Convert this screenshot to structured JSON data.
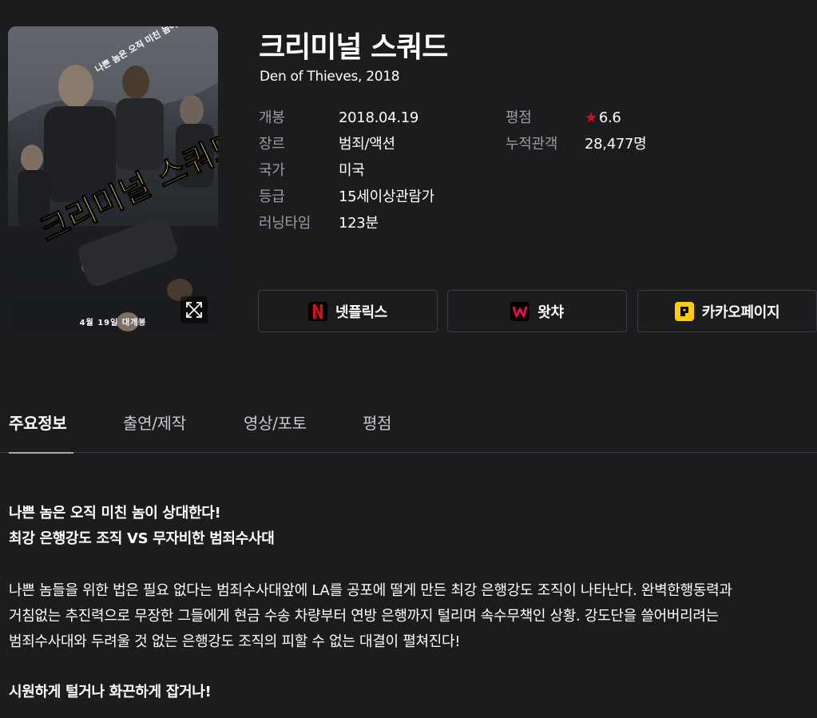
{
  "movie": {
    "title": "크리미널 스쿼드",
    "original_title_year": "Den of Thieves, 2018",
    "poster": {
      "tagline": "나쁜 놈은 오직 미친 놈이 상대한다!",
      "title_art": "크리미널 스쿼드",
      "release_note": "4월 19일 대개봉"
    }
  },
  "info": {
    "release_label": "개봉",
    "release_value": "2018.04.19",
    "genre_label": "장르",
    "genre_value": "범죄/액션",
    "country_label": "국가",
    "country_value": "미국",
    "rating_label": "등급",
    "rating_value": "15세이상관람가",
    "runtime_label": "러닝타임",
    "runtime_value": "123분",
    "score_label": "평점",
    "score_value": "6.6",
    "audience_label": "누적관객",
    "audience_value": "28,477명"
  },
  "ott": [
    {
      "label": "넷플릭스",
      "icon": "netflix-logo",
      "color": "#e50914"
    },
    {
      "label": "왓챠",
      "icon": "watcha-logo",
      "color": "#ff0558"
    },
    {
      "label": "카카오페이지",
      "icon": "kakaopage-logo",
      "color": "#ffcd00"
    }
  ],
  "tabs": [
    "주요정보",
    "출연/제작",
    "영상/포토",
    "평점"
  ],
  "synopsis": {
    "headline1": "나쁜 놈은 오직 미친 놈이 상대한다!",
    "headline2": "최강 은행강도 조직 VS 무자비한 범죄수사대",
    "body1": "나쁜 놈들을 위한 법은 필요 없다는 범죄수사대앞에 LA를 공포에 떨게 만든 최강 은행강도 조직이 나타난다. 완벽한행동력과",
    "body2": "거침없는 추진력으로 무장한 그들에게 현금 수송 차량부터 연방 은행까지 털리며 속수무책인 상황. 강도단을 쓸어버리려는",
    "body3": "범죄수사대와 두려울 것 없는 은행강도 조직의 피할 수 없는 대결이 펼쳐진다!",
    "closing": "시원하게 털거나 화끈하게 잡거나!"
  },
  "colors": {
    "background": "#1b1c1e",
    "accent_star": "#e50914",
    "poster_title": "#f5e11a"
  }
}
